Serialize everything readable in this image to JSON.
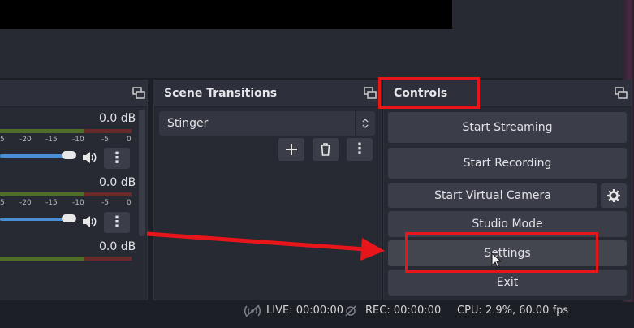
{
  "mixer": {
    "channels": [
      {
        "db": "0.0 dB",
        "ticks": [
          "5",
          "-20",
          "-15",
          "-10",
          "-5",
          "0"
        ]
      },
      {
        "db": "0.0 dB",
        "ticks": [
          "5",
          "-20",
          "-15",
          "-10",
          "-5",
          "0"
        ]
      },
      {
        "db": "0.0 dB",
        "ticks": [
          "5",
          "-20",
          "-15",
          "-10",
          "-5",
          "0"
        ]
      }
    ]
  },
  "transitions": {
    "title": "Scene Transitions",
    "selected": "Stinger"
  },
  "controls": {
    "title": "Controls",
    "start_streaming": "Start Streaming",
    "start_recording": "Start Recording",
    "start_virtual_camera": "Start Virtual Camera",
    "studio_mode": "Studio Mode",
    "settings": "Settings",
    "exit": "Exit"
  },
  "status": {
    "live": "LIVE: 00:00:00",
    "rec": "REC: 00:00:00",
    "cpu": "CPU: 2.9%, 60.00 fps"
  },
  "colors": {
    "highlight": "#e8161b",
    "slider": "#4a8fd6"
  }
}
